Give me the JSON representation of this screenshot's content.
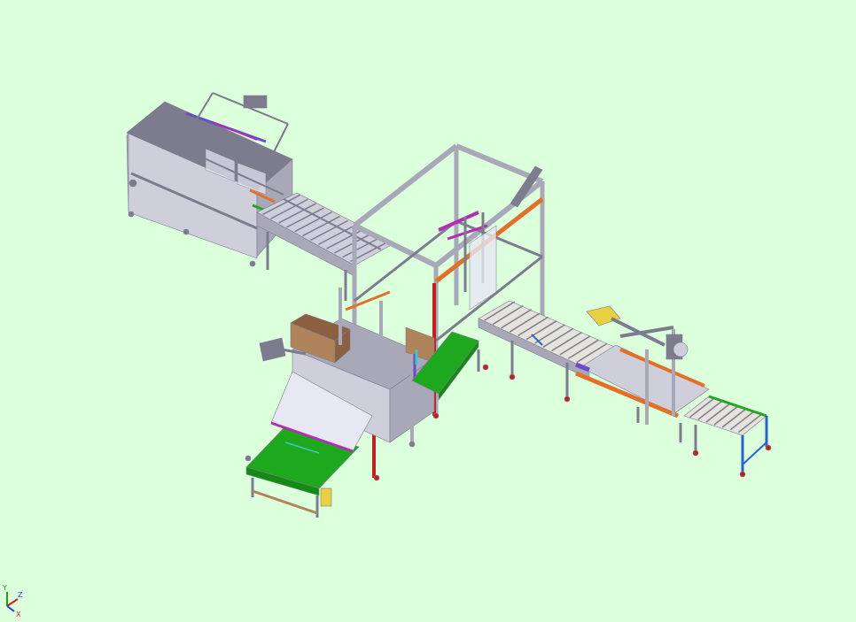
{
  "viewport": {
    "background": "#dcffdc"
  },
  "colors": {
    "frame": "#a8a8b8",
    "frame_dark": "#7c7c8e",
    "frame_light": "#cfcfdc",
    "roller": "#e6e2dc",
    "conveyor_green": "#1ea81e",
    "conveyor_green_dark": "#138a13",
    "box": "#b0835a",
    "box_dark": "#8a6040",
    "orange": "#e2702a",
    "magenta": "#b030b0",
    "purple": "#6a4cc8",
    "yellow": "#e8d040",
    "blue": "#2a64c8",
    "red": "#c02020",
    "sheet": "#e8e8f4",
    "cyan": "#40c8c8"
  },
  "triad": {
    "x_label": "X",
    "y_label": "Y",
    "z_label": "Z",
    "x_color": "#d02020",
    "y_color": "#20a020",
    "z_color": "#2040d0"
  }
}
